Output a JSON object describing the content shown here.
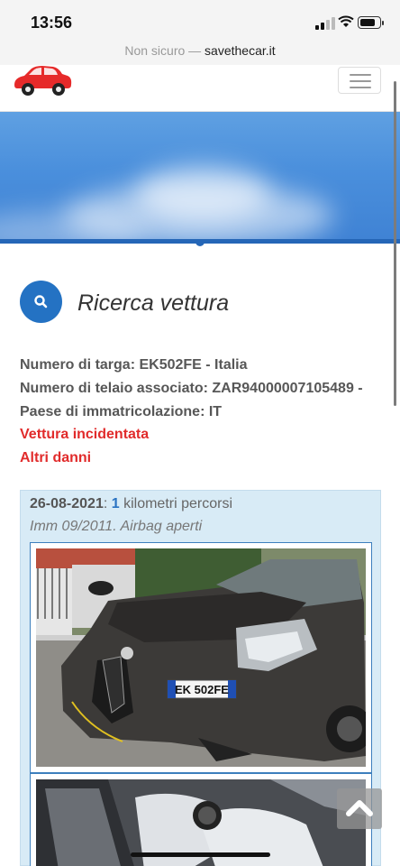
{
  "status_bar": {
    "time": "13:56"
  },
  "browser": {
    "security_label": "Non sicuro",
    "separator": " — ",
    "domain": "savethecar.it"
  },
  "header": {
    "logo_icon": "red-car-icon",
    "menu_icon": "hamburger-icon"
  },
  "search_section": {
    "icon": "search-icon",
    "title": "Ricerca vettura"
  },
  "vehicle_info": {
    "plate_line": "Numero di targa: EK502FE - Italia",
    "chassis_line": "Numero di telaio associato: ZAR94000007105489 -",
    "country_line": "Paese di immatricolazione: IT",
    "accident_label": "Vettura incidentata",
    "other_damage_label": "Altri danni"
  },
  "record": {
    "date": "26-08-2021",
    "colon": ": ",
    "km_value": "1",
    "km_label": " kilometri percorsi",
    "note": "Imm 09/2011. Airbag aperti",
    "photo1_plate": "EK 502FE"
  },
  "scroll_top_icon": "chevron-up-icon",
  "colors": {
    "accent_blue": "#2472c3",
    "alert_red": "#e12b2b",
    "card_bg": "#d8ebf6"
  }
}
